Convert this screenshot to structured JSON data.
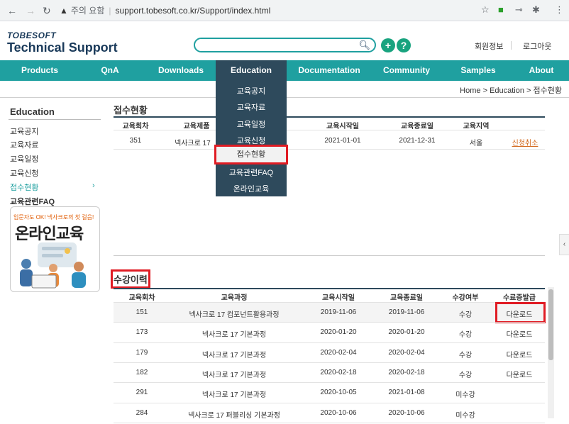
{
  "browser": {
    "security_label": "주의 요함",
    "url": "support.tobesoft.co.kr/Support/index.html"
  },
  "header": {
    "logo_top": "TOBESOFT",
    "logo_main": "Technical Support",
    "search_placeholder": "",
    "links": [
      "회원정보",
      "로그아웃"
    ]
  },
  "nav": {
    "items": [
      "Products",
      "QnA",
      "Downloads",
      "Education",
      "Documentation",
      "Community",
      "Samples",
      "About"
    ],
    "active": "Education"
  },
  "dropdown": {
    "items": [
      "교육공지",
      "교육자료",
      "교육일정",
      "교육신청",
      "접수현황",
      "교육관련FAQ",
      "온라인교육"
    ],
    "highlighted": "접수현황"
  },
  "breadcrumb": "Home > Education > 접수현황",
  "sidebar": {
    "title": "Education",
    "items": [
      "교육공지",
      "교육자료",
      "교육일정",
      "교육신청",
      "접수현황",
      "교육관련FAQ"
    ],
    "active_index": 4,
    "banner_sub": "입문자도 OK! 넥사크로의 첫 걸음!",
    "banner_main": "온라인교육"
  },
  "reception": {
    "title": "접수현황",
    "headers": [
      "교육회차",
      "교육제품",
      "교육시작일",
      "교육종료일",
      "교육지역"
    ],
    "rows": [
      {
        "round": "351",
        "product": "넥사크로 17",
        "start": "2021-01-01",
        "end": "2021-12-31",
        "region": "서울",
        "action": "신청취소"
      }
    ]
  },
  "history": {
    "title": "수강이력",
    "headers": [
      "교육회차",
      "교육과정",
      "교육시작일",
      "교육종료일",
      "수강여부",
      "수료증발급"
    ],
    "rows": [
      {
        "round": "151",
        "course": "넥사크로 17 컴포넌트활용과정",
        "start": "2019-11-06",
        "end": "2019-11-06",
        "status": "수강",
        "cert": "다운로드"
      },
      {
        "round": "173",
        "course": "넥사크로 17 기본과정",
        "start": "2020-01-20",
        "end": "2020-01-20",
        "status": "수강",
        "cert": "다운로드"
      },
      {
        "round": "179",
        "course": "넥사크로 17 기본과정",
        "start": "2020-02-04",
        "end": "2020-02-04",
        "status": "수강",
        "cert": "다운로드"
      },
      {
        "round": "182",
        "course": "넥사크로 17 기본과정",
        "start": "2020-02-18",
        "end": "2020-02-18",
        "status": "수강",
        "cert": "다운로드"
      },
      {
        "round": "291",
        "course": "넥사크로 17 기본과정",
        "start": "2020-10-05",
        "end": "2021-01-08",
        "status": "미수강",
        "cert": ""
      },
      {
        "round": "284",
        "course": "넥사크로 17 퍼블리싱 기본과정",
        "start": "2020-10-06",
        "end": "2020-10-06",
        "status": "미수강",
        "cert": ""
      }
    ]
  }
}
